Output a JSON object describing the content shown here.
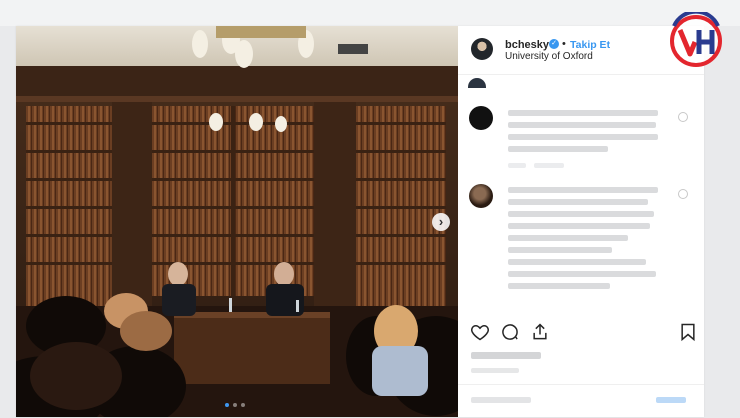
{
  "post": {
    "username": "bchesky",
    "verified_icon": "verified-badge-icon",
    "separator": "•",
    "follow_label": "Takip Et",
    "location": "University of Oxford"
  },
  "photo": {
    "next_icon": "chevron-right-icon",
    "next_glyph": "›",
    "carousel_count": 3,
    "carousel_active": 1
  },
  "actions": {
    "like_icon": "heart-icon",
    "comment_icon": "comment-icon",
    "share_icon": "share-icon",
    "save_icon": "bookmark-icon"
  },
  "colors": {
    "link_blue": "#3897f0",
    "text": "#262626",
    "logo_red": "#e3262e",
    "logo_blue": "#2a3b8f"
  },
  "watermark": {
    "text": "VH"
  }
}
